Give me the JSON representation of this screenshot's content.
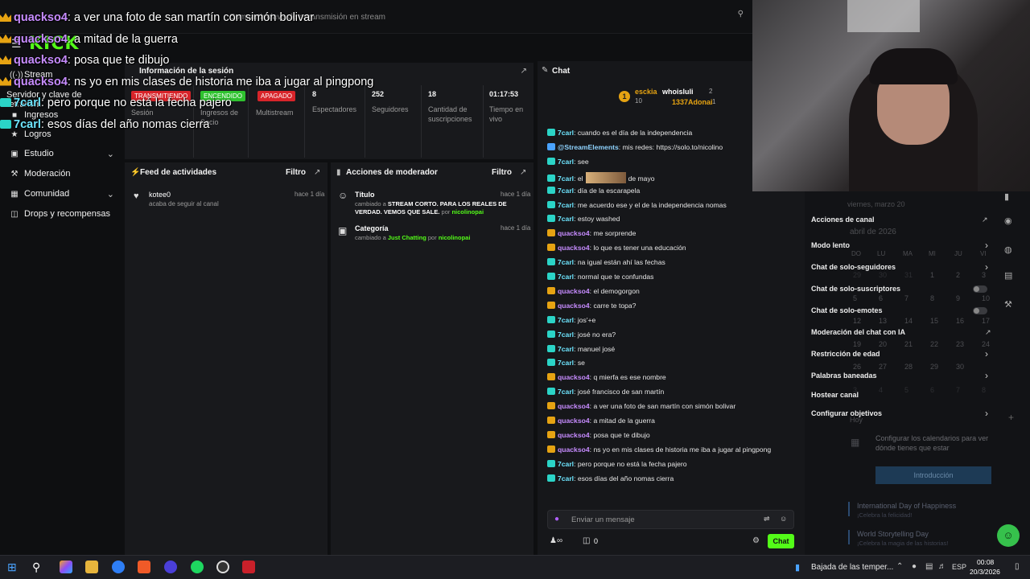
{
  "header": {
    "logo_text": "KICK",
    "search_text": "Compartir clave de retransmisión en stream"
  },
  "sidebar": {
    "items": [
      {
        "label": "Stream"
      },
      {
        "label": "Servidor y clave de retransm"
      },
      {
        "label": "Ingresos"
      },
      {
        "label": "Logros"
      },
      {
        "label": "Estudio"
      },
      {
        "label": "Moderación"
      },
      {
        "label": "Comunidad"
      },
      {
        "label": "Drops y recompensas"
      }
    ]
  },
  "session": {
    "title": "Información de la sesión",
    "badges": {
      "live": "TRANSMITIENDO",
      "on": "ENCENDIDO",
      "off": "APAGADO"
    },
    "labels": {
      "session": "Sesión",
      "income": "Ingresos de Socio",
      "multistream": "Multistream"
    },
    "stats": [
      {
        "value": "8",
        "label": "Espectadores"
      },
      {
        "value": "252",
        "label": "Seguidores"
      },
      {
        "value": "18",
        "label": "Cantidad de suscripciones"
      },
      {
        "value": "01:17:53",
        "label": "Tiempo en vivo"
      }
    ]
  },
  "activity": {
    "title": "Feed de actividades",
    "filter": "Filtro",
    "items": [
      {
        "user": "kotee0",
        "text": "acaba de seguir al canal",
        "time": "hace 1 día"
      }
    ]
  },
  "modactions": {
    "title": "Acciones de moderador",
    "filter": "Filtro",
    "items": [
      {
        "title": "Título",
        "time": "hace 1 día",
        "pre": "cambiado a",
        "value": "STREAM CORTO. PARA LOS REALES DE VERDAD. VEMOS QUE SALE.",
        "by": "por",
        "user": "nicolinopai"
      },
      {
        "title": "Categoría",
        "time": "hace 1 día",
        "pre": "cambiado a",
        "value": "Just Chatting",
        "by": "por",
        "user": "nicolinopai"
      }
    ]
  },
  "chat": {
    "title": "Chat",
    "leaders": [
      {
        "name": "esckia",
        "count": "10"
      },
      {
        "name": "whoisluli",
        "count": "2"
      },
      {
        "name": "1337Adonai",
        "count": "1"
      }
    ],
    "messages": [
      {
        "user": "7carl",
        "text": "cuando es el día de la independencia",
        "type": "7"
      },
      {
        "user": "@StreamElements",
        "text": "mis redes: https://solo.to/nicolino",
        "type": "se"
      },
      {
        "user": "7carl",
        "text": "see",
        "type": "7"
      },
      {
        "user": "7carl",
        "text": "el",
        "type": "7",
        "suffix": "de mayo"
      },
      {
        "user": "7carl",
        "text": "día de la escarapela",
        "type": "7"
      },
      {
        "user": "7carl",
        "text": "me acuerdo ese y el de la independencia nomas",
        "type": "7"
      },
      {
        "user": "7carl",
        "text": "estoy washed",
        "type": "7"
      },
      {
        "user": "quackso4",
        "text": "me sorprende",
        "type": "q"
      },
      {
        "user": "quackso4",
        "text": "lo que es tener una educación",
        "type": "q"
      },
      {
        "user": "7carl",
        "text": "na igual están ahí las fechas",
        "type": "7"
      },
      {
        "user": "7carl",
        "text": "normal que te confundas",
        "type": "7"
      },
      {
        "user": "quackso4",
        "text": "el demogorgon",
        "type": "q"
      },
      {
        "user": "quackso4",
        "text": "carre te topa?",
        "type": "q"
      },
      {
        "user": "7carl",
        "text": "jos'+e",
        "type": "7"
      },
      {
        "user": "7carl",
        "text": "josé no era?",
        "type": "7"
      },
      {
        "user": "7carl",
        "text": "manuel josé",
        "type": "7"
      },
      {
        "user": "7carl",
        "text": "se",
        "type": "7"
      },
      {
        "user": "quackso4",
        "text": "q mierfa es ese nombre",
        "type": "q"
      },
      {
        "user": "7carl",
        "text": "josé francisco de san martín",
        "type": "7"
      },
      {
        "user": "quackso4",
        "text": "a ver una foto de san martín con simón bolivar",
        "type": "q"
      },
      {
        "user": "quackso4",
        "text": "a mitad de la guerra",
        "type": "q"
      },
      {
        "user": "quackso4",
        "text": "posa que te dibujo",
        "type": "q"
      },
      {
        "user": "quackso4",
        "text": "ns yo en mis clases de historia me iba a jugar al pingpong",
        "type": "q"
      },
      {
        "user": "7carl",
        "text": "pero porque no está la fecha pajero",
        "type": "7"
      },
      {
        "user": "7carl",
        "text": "esos días del año nomas cierra",
        "type": "7"
      }
    ],
    "input_placeholder": "Enviar un mensaje",
    "points": "0",
    "send_label": "Chat"
  },
  "overlay": {
    "lines": [
      {
        "user": "quackso4",
        "text": ": a ver una foto de san martín con simón bolivar",
        "type": "q"
      },
      {
        "user": "quackso4",
        "text": ": a mitad de la guerra",
        "type": "q"
      },
      {
        "user": "quackso4",
        "text": ": posa que te dibujo",
        "type": "q"
      },
      {
        "user": "quackso4",
        "text": ": ns yo en mis clases de historia me iba a jugar al pingpong",
        "type": "q"
      },
      {
        "user": "7carl",
        "text": ": pero porque no está la fecha pajero",
        "type": "7"
      },
      {
        "user": "7carl",
        "text": ": esos días del año nomas cierra",
        "type": "7"
      }
    ]
  },
  "channel_actions": {
    "title": "Acciones de canal",
    "items": [
      {
        "label": "Modo lento"
      },
      {
        "label": "Chat de solo-seguidores"
      },
      {
        "label": "Chat de solo-suscriptores"
      },
      {
        "label": "Chat de solo-emotes"
      },
      {
        "label": "Moderación del chat con IA"
      },
      {
        "label": "Restricción de edad"
      },
      {
        "label": "Palabras baneadas"
      },
      {
        "label": "Hostear canal"
      },
      {
        "label": "Configurar objetivos"
      }
    ]
  },
  "calendar": {
    "date_header": "viernes, marzo 20",
    "month": "abril de 2026",
    "weekdays": [
      "DO",
      "LU",
      "MA",
      "MI",
      "JU",
      "VI"
    ],
    "today": "Hoy",
    "config_text": "Configurar los calendarios para ver dónde tienes que estar",
    "intro_button": "Introducción",
    "events": [
      {
        "title": "International Day of Happiness",
        "sub": "¡Celebra la felicidad!"
      },
      {
        "title": "World Storytelling Day",
        "sub": "¡Celebra la magia de las historias!"
      }
    ]
  },
  "taskbar": {
    "weather": "Bajada de las temper...",
    "lang": "ESP",
    "time": "00:08",
    "date": "20/3/2026"
  }
}
